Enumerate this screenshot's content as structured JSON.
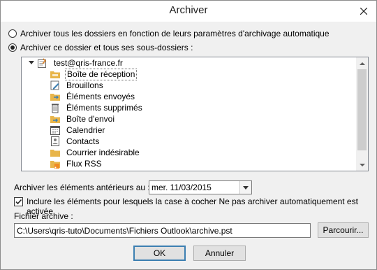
{
  "window": {
    "title": "Archiver"
  },
  "options": {
    "archive_all": "Archiver tous les dossiers en fonction de leurs paramètres d'archivage automatique",
    "archive_folder": "Archiver ce dossier et tous ses sous-dossiers :",
    "selected": "archive_folder"
  },
  "tree": {
    "root": "test@qris-france.fr",
    "items": [
      {
        "label": "Boîte de réception",
        "icon": "inbox-icon"
      },
      {
        "label": "Brouillons",
        "icon": "drafts-icon"
      },
      {
        "label": "Éléments envoyés",
        "icon": "sent-icon"
      },
      {
        "label": "Éléments supprimés",
        "icon": "trash-icon"
      },
      {
        "label": "Boîte d'envoi",
        "icon": "outbox-icon"
      },
      {
        "label": "Calendrier",
        "icon": "calendar-icon"
      },
      {
        "label": "Contacts",
        "icon": "contacts-icon"
      },
      {
        "label": "Courrier indésirable",
        "icon": "junk-folder-icon"
      },
      {
        "label": "Flux RSS",
        "icon": "rss-icon"
      }
    ],
    "selected_index": 0
  },
  "archive_before": {
    "label": "Archiver les éléments antérieurs au :",
    "value": "mer. 11/03/2015"
  },
  "include_checkbox": {
    "label": "Inclure les éléments pour lesquels la case à cocher Ne pas archiver automatiquement est activée",
    "checked": true
  },
  "archive_file": {
    "label": "Fichier archive :",
    "value": "C:\\Users\\qris-tuto\\Documents\\Fichiers Outlook\\archive.pst",
    "browse": "Parcourir..."
  },
  "buttons": {
    "ok": "OK",
    "cancel": "Annuler"
  },
  "colors": {
    "folder": "#e8b54a",
    "accent": "#3c7fb1"
  }
}
